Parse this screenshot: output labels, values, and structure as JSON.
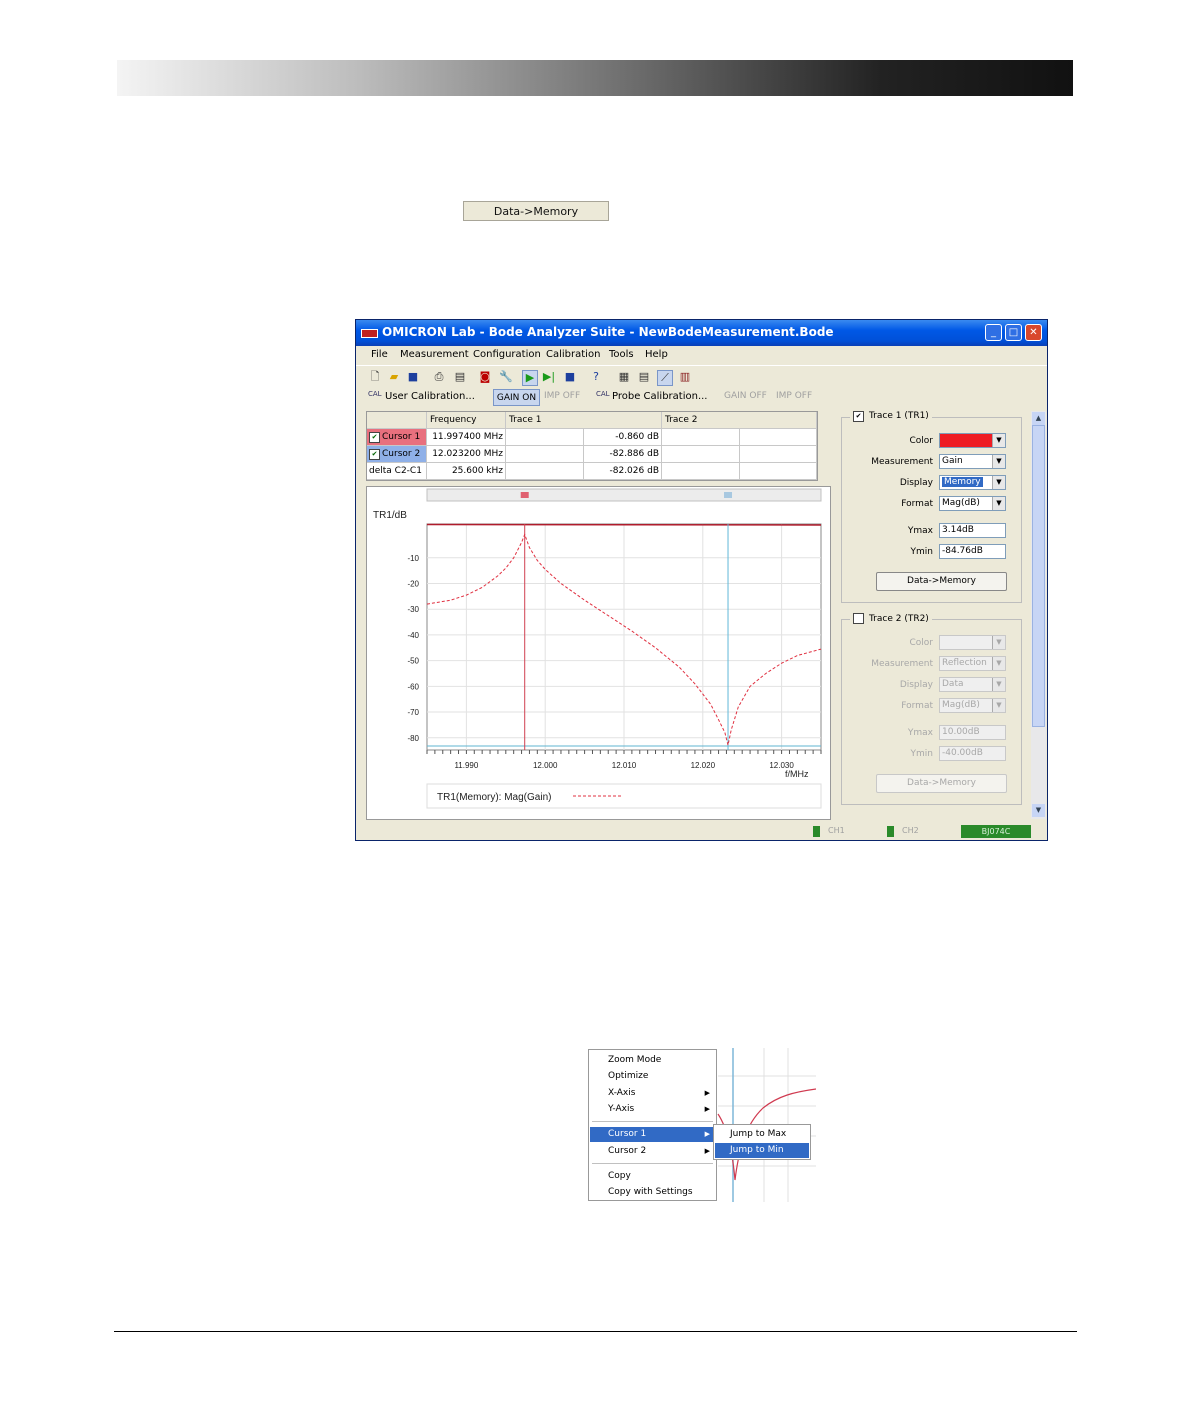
{
  "page_button": {
    "label": "Data->Memory"
  },
  "window": {
    "title": "OMICRON Lab - Bode Analyzer Suite - NewBodeMeasurement.Bode",
    "menu": [
      "File",
      "Measurement",
      "Configuration",
      "Calibration",
      "Tools",
      "Help"
    ],
    "calbar": {
      "user_cal": "User Calibration...",
      "gain_on": "GAIN ON",
      "imp_off": "IMP OFF",
      "probe_cal": "Probe Calibration...",
      "gain_off": "GAIN OFF",
      "imp_off2": "IMP OFF",
      "cal_icon": "CAL"
    }
  },
  "cursor_table": {
    "headers": [
      "Frequency",
      "Trace 1",
      "Trace 2"
    ],
    "rows": [
      {
        "name": "Cursor 1",
        "freq": "11.997400 MHz",
        "t1": "-0.860 dB",
        "color": "#e8707e"
      },
      {
        "name": "Cursor 2",
        "freq": "12.023200 MHz",
        "t1": "-82.886 dB",
        "color": "#8fb0e8"
      },
      {
        "name": "delta C2-C1",
        "freq": "25.600 kHz",
        "t1": "-82.026 dB"
      }
    ]
  },
  "chart_data": {
    "type": "line",
    "ylabel": "TR1/dB",
    "xlabel": "f/MHz",
    "xlim": [
      11.985,
      12.035
    ],
    "ylim": [
      -84.76,
      3.14
    ],
    "x_ticks": [
      "11.990",
      "12.000",
      "12.010",
      "12.020",
      "12.030"
    ],
    "y_ticks": [
      "-10",
      "-20",
      "-30",
      "-40",
      "-50",
      "-60",
      "-70",
      "-80"
    ],
    "cursor1_x": 11.9974,
    "cursor2_x": 12.0232,
    "legend": "TR1(Memory): Mag(Gain)",
    "series_color": "#e03040",
    "series": [
      {
        "x": [
          11.985,
          11.988,
          11.99,
          11.992,
          11.994,
          11.995,
          11.996,
          11.997,
          11.9974,
          11.998,
          11.999,
          12.0,
          12.002,
          12.005,
          12.008,
          12.011,
          12.014,
          12.017,
          12.019,
          12.021,
          12.022,
          12.0228,
          12.0232,
          12.0236,
          12.0245,
          12.026,
          12.028,
          12.03,
          12.032,
          12.035
        ],
        "y": [
          -28,
          -26.5,
          -24.5,
          -21.5,
          -17,
          -14,
          -10,
          -4,
          -0.9,
          -6,
          -11,
          -14.5,
          -20,
          -26.5,
          -32.5,
          -38.5,
          -45,
          -52.5,
          -59,
          -67,
          -73,
          -78,
          -82.9,
          -77,
          -68,
          -60,
          -55,
          -51,
          -48,
          -45.5
        ]
      }
    ]
  },
  "trace1": {
    "title": "Trace 1 (TR1)",
    "labels": {
      "color": "Color",
      "measurement": "Measurement",
      "display": "Display",
      "format": "Format",
      "ymax": "Ymax",
      "ymin": "Ymin"
    },
    "color": "#ee1c24",
    "measurement": "Gain",
    "display": "Memory",
    "format": "Mag(dB)",
    "ymax": "3.14dB",
    "ymin": "-84.76dB",
    "button": "Data->Memory"
  },
  "trace2": {
    "title": "Trace 2 (TR2)",
    "labels": {
      "color": "Color",
      "measurement": "Measurement",
      "display": "Display",
      "format": "Format",
      "ymax": "Ymax",
      "ymin": "Ymin"
    },
    "measurement": "Reflection",
    "display": "Data",
    "format": "Mag(dB)",
    "ymax": "10.00dB",
    "ymin": "-40.00dB",
    "button": "Data->Memory"
  },
  "status": {
    "ch1": "CH1",
    "ch2": "CH2",
    "device": "BJ074C"
  },
  "context_menu": {
    "items": [
      "Zoom Mode",
      "Optimize",
      "X-Axis",
      "Y-Axis",
      "Cursor 1",
      "Cursor 2",
      "Copy",
      "Copy with Settings"
    ],
    "submenu": [
      "Jump to Max",
      "Jump to Min"
    ]
  }
}
